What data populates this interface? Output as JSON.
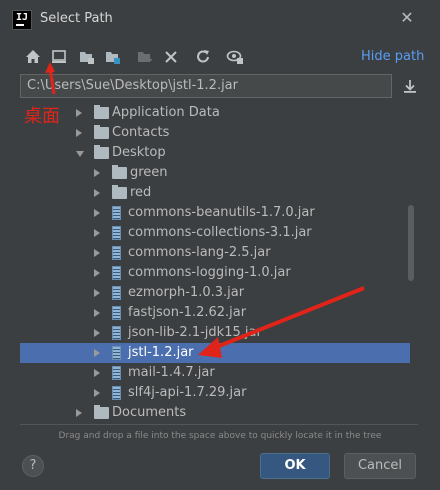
{
  "window": {
    "title": "Select Path",
    "close_icon": "close-icon"
  },
  "toolbar": {
    "icons": [
      "home-icon",
      "desktop-icon",
      "project-icon",
      "module-icon",
      "new-folder-icon",
      "delete-icon",
      "refresh-icon",
      "show-hidden-icon"
    ],
    "hide_path_label": "Hide path"
  },
  "path": {
    "value": "C:\\Users\\Sue\\Desktop\\jstl-1.2.jar"
  },
  "annotation": {
    "text": "桌面",
    "color": "#e0241a"
  },
  "tree": {
    "items": [
      {
        "label": "Application Data",
        "type": "folder",
        "expanded": false
      },
      {
        "label": "Contacts",
        "type": "folder",
        "expanded": false
      },
      {
        "label": "Desktop",
        "type": "folder",
        "expanded": true
      },
      {
        "label": "green",
        "type": "folder",
        "expanded": false
      },
      {
        "label": "red",
        "type": "folder",
        "expanded": false
      },
      {
        "label": "commons-beanutils-1.7.0.jar",
        "type": "jar"
      },
      {
        "label": "commons-collections-3.1.jar",
        "type": "jar"
      },
      {
        "label": "commons-lang-2.5.jar",
        "type": "jar"
      },
      {
        "label": "commons-logging-1.0.jar",
        "type": "jar"
      },
      {
        "label": "ezmorph-1.0.3.jar",
        "type": "jar"
      },
      {
        "label": "fastjson-1.2.62.jar",
        "type": "jar"
      },
      {
        "label": "json-lib-2.1-jdk15.jar",
        "type": "jar"
      },
      {
        "label": "jstl-1.2.jar",
        "type": "jar",
        "selected": true
      },
      {
        "label": "mail-1.4.7.jar",
        "type": "jar"
      },
      {
        "label": "slf4j-api-1.7.29.jar",
        "type": "jar"
      },
      {
        "label": "Documents",
        "type": "folder",
        "expanded": false
      }
    ]
  },
  "hint": "Drag and drop a file into the space above to quickly locate it in the tree",
  "buttons": {
    "help": "?",
    "ok": "OK",
    "cancel": "Cancel"
  },
  "colors": {
    "selection": "#4b6eaf",
    "accent_link": "#589df6",
    "ok_button": "#365880",
    "annotation": "#e0241a"
  }
}
